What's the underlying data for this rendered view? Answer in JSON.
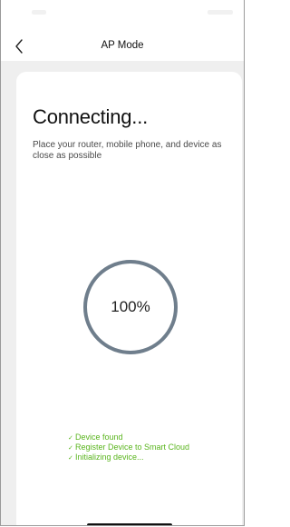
{
  "header": {
    "title": "AP Mode"
  },
  "main": {
    "title": "Connecting...",
    "subtitle": "Place your router, mobile phone, and device as close as possible",
    "progress": {
      "percent": 100,
      "label": "100%"
    },
    "steps": [
      "Device found",
      "Register Device to Smart Cloud",
      "Initializing device..."
    ]
  },
  "icons": {
    "back": "chevron-left-icon",
    "step_status": "check-icon"
  },
  "colors": {
    "background": "#efefef",
    "card": "#ffffff",
    "ring": "#6f7e8c",
    "success": "#5ab51e"
  }
}
